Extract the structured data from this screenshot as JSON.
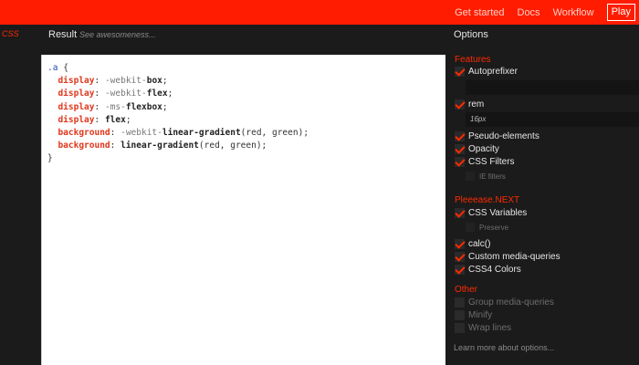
{
  "nav": {
    "links": [
      "Get started",
      "Docs",
      "Workflow"
    ],
    "play_label": "Play"
  },
  "left": {
    "css_label": "CSS"
  },
  "result": {
    "title": "Result",
    "hint": "See awesomeness..."
  },
  "code": {
    "selector": ".a",
    "open": "{",
    "close": "}",
    "lines": [
      {
        "prop": "display",
        "colon": ": ",
        "prefix": "-webkit-",
        "value": "box",
        "end": ";"
      },
      {
        "prop": "display",
        "colon": ": ",
        "prefix": "-webkit-",
        "value": "flex",
        "end": ";"
      },
      {
        "prop": "display",
        "colon": ": ",
        "prefix": "-ms-",
        "value": "flexbox",
        "end": ";"
      },
      {
        "prop": "display",
        "colon": ": ",
        "prefix": "",
        "value": "flex",
        "end": ";"
      },
      {
        "prop": "background",
        "colon": ": ",
        "prefix": "-webkit-",
        "value": "linear-gradient",
        "args": "(red, green)",
        "end": ";"
      },
      {
        "prop": "background",
        "colon": ": ",
        "prefix": "",
        "value": "linear-gradient",
        "args": "(red, green)",
        "end": ";"
      }
    ]
  },
  "options": {
    "title": "Options",
    "features": {
      "heading": "Features",
      "autoprefixer": "Autoprefixer",
      "rem": "rem",
      "rem_value": "16px",
      "pseudo": "Pseudo-elements",
      "opacity": "Opacity",
      "filters": "CSS Filters",
      "ie_filters": "IE filters"
    },
    "next": {
      "heading": "Pleeease.NEXT",
      "variables": "CSS Variables",
      "preserve": "Preserve",
      "calc": "calc()",
      "media": "Custom media-queries",
      "colors": "CSS4 Colors"
    },
    "other": {
      "heading": "Other",
      "group": "Group media-queries",
      "minify": "Minify",
      "wrap": "Wrap lines"
    },
    "learn_more": "Learn more about options..."
  },
  "colors": {
    "accent": "#ff2a00",
    "topbar": "#ff1c00",
    "panel": "#1b1b1b"
  }
}
